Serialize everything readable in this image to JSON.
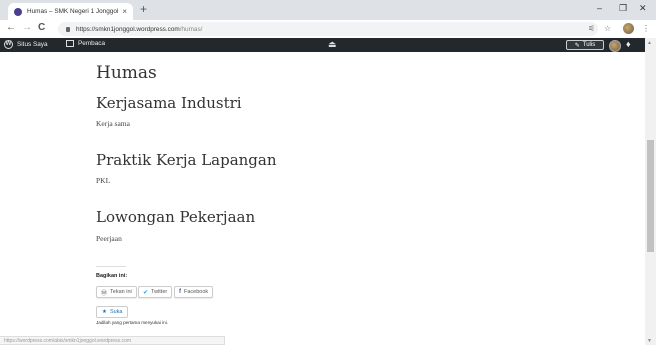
{
  "browser": {
    "tab_title": "Humas – SMK Negeri 1 Jonggol",
    "tab_close": "×",
    "new_tab": "+",
    "url_host": "https://smkn1jonggol.wordpress.com",
    "url_path": "/humas/",
    "back": "←",
    "forward": "→",
    "reload": "C",
    "window_min": "–",
    "window_max": "❐",
    "window_close": "✕",
    "status_url": "https://wordpress.com/abis/smkn1jonggol.wordpress.com"
  },
  "adminbar": {
    "my_site": "Situs Saya",
    "reader": "Pembaca",
    "write": "Tulis"
  },
  "page": {
    "title": "Humas",
    "sections": [
      {
        "heading": "Kerjasama Industri",
        "text": "Kerja sama"
      },
      {
        "heading": "Praktik Kerja Lapangan",
        "text": "PKL"
      },
      {
        "heading": "Lowongan Pekerjaan",
        "text": "Peerjaan"
      }
    ]
  },
  "share": {
    "label": "Bagikan ini:",
    "buttons": [
      "Tekan ini",
      "Twitter",
      "Facebook"
    ]
  },
  "like": {
    "button": "Suka",
    "note": "Jadilah yang pertama menyukai ini."
  },
  "colors": {
    "adminbar_bg": "#23282d",
    "tabstrip_bg": "#dee1e6",
    "link_blue": "#2271b1"
  }
}
